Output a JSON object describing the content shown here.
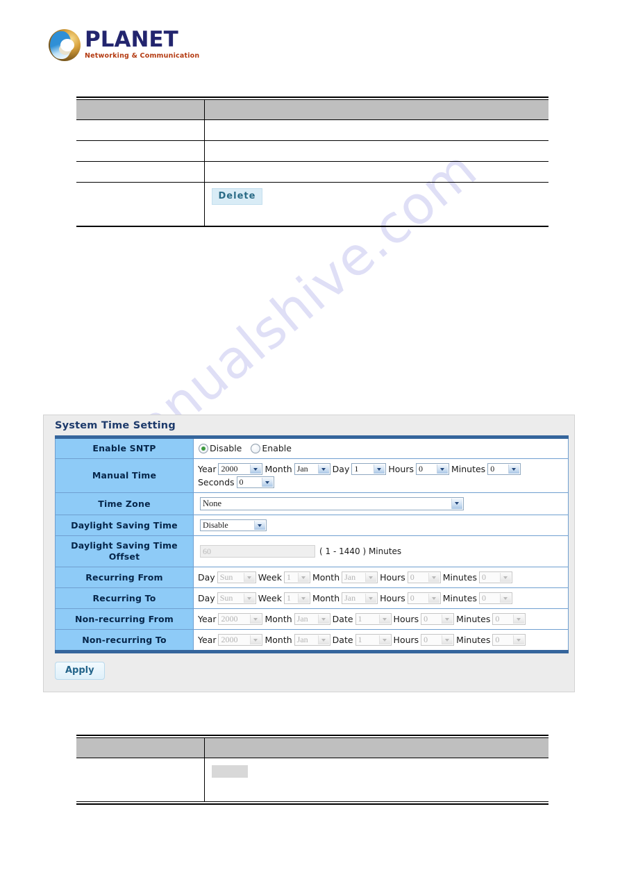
{
  "brand": {
    "name": "PLANET",
    "tagline": "Networking & Communication",
    "logo_icon": "planet-globe-icon"
  },
  "watermark": {
    "text": "manualshive.com"
  },
  "top_table": {
    "header": [
      "",
      ""
    ],
    "rows": [
      {
        "label": "",
        "value": ""
      },
      {
        "label": "",
        "value": ""
      },
      {
        "label": "",
        "value": ""
      },
      {
        "label": "",
        "value": "",
        "button": "Delete"
      }
    ]
  },
  "bottom_table": {
    "header": [
      "",
      ""
    ],
    "rows": [
      {
        "label": "",
        "value": ""
      }
    ]
  },
  "panel": {
    "title": "System Time Setting",
    "apply_label": "Apply",
    "rows": {
      "enable_sntp": {
        "label": "Enable SNTP",
        "options": [
          "Disable",
          "Enable"
        ],
        "selected": "Disable"
      },
      "manual_time": {
        "label": "Manual Time",
        "fields": [
          {
            "name": "Year",
            "value": "2000"
          },
          {
            "name": "Month",
            "value": "Jan"
          },
          {
            "name": "Day",
            "value": "1"
          },
          {
            "name": "Hours",
            "value": "0"
          },
          {
            "name": "Minutes",
            "value": "0"
          },
          {
            "name": "Seconds",
            "value": "0"
          }
        ]
      },
      "time_zone": {
        "label": "Time Zone",
        "value": "None"
      },
      "daylight_saving_time": {
        "label": "Daylight Saving Time",
        "value": "Disable"
      },
      "daylight_saving_time_offset": {
        "label": "Daylight Saving Time Offset",
        "value": "60",
        "hint": "( 1 - 1440 ) Minutes"
      },
      "recurring_from": {
        "label": "Recurring From",
        "fields": [
          {
            "name": "Day",
            "value": "Sun"
          },
          {
            "name": "Week",
            "value": "1"
          },
          {
            "name": "Month",
            "value": "Jan"
          },
          {
            "name": "Hours",
            "value": "0"
          },
          {
            "name": "Minutes",
            "value": "0"
          }
        ]
      },
      "recurring_to": {
        "label": "Recurring To",
        "fields": [
          {
            "name": "Day",
            "value": "Sun"
          },
          {
            "name": "Week",
            "value": "1"
          },
          {
            "name": "Month",
            "value": "Jan"
          },
          {
            "name": "Hours",
            "value": "0"
          },
          {
            "name": "Minutes",
            "value": "0"
          }
        ]
      },
      "non_recurring_from": {
        "label": "Non-recurring From",
        "fields": [
          {
            "name": "Year",
            "value": "2000"
          },
          {
            "name": "Month",
            "value": "Jan"
          },
          {
            "name": "Date",
            "value": "1"
          },
          {
            "name": "Hours",
            "value": "0"
          },
          {
            "name": "Minutes",
            "value": "0"
          }
        ]
      },
      "non_recurring_to": {
        "label": "Non-recurring To",
        "fields": [
          {
            "name": "Year",
            "value": "2000"
          },
          {
            "name": "Month",
            "value": "Jan"
          },
          {
            "name": "Date",
            "value": "1"
          },
          {
            "name": "Hours",
            "value": "0"
          },
          {
            "name": "Minutes",
            "value": "0"
          }
        ]
      }
    }
  },
  "colors": {
    "label_cell": "#8ecbf7",
    "panel_bg": "#ececec",
    "table_rule": "#35659c",
    "doc_header": "#bfbfbf",
    "title_text": "#1d3a6b",
    "brand_text": "#23256e",
    "brand_tag": "#b43b12"
  }
}
